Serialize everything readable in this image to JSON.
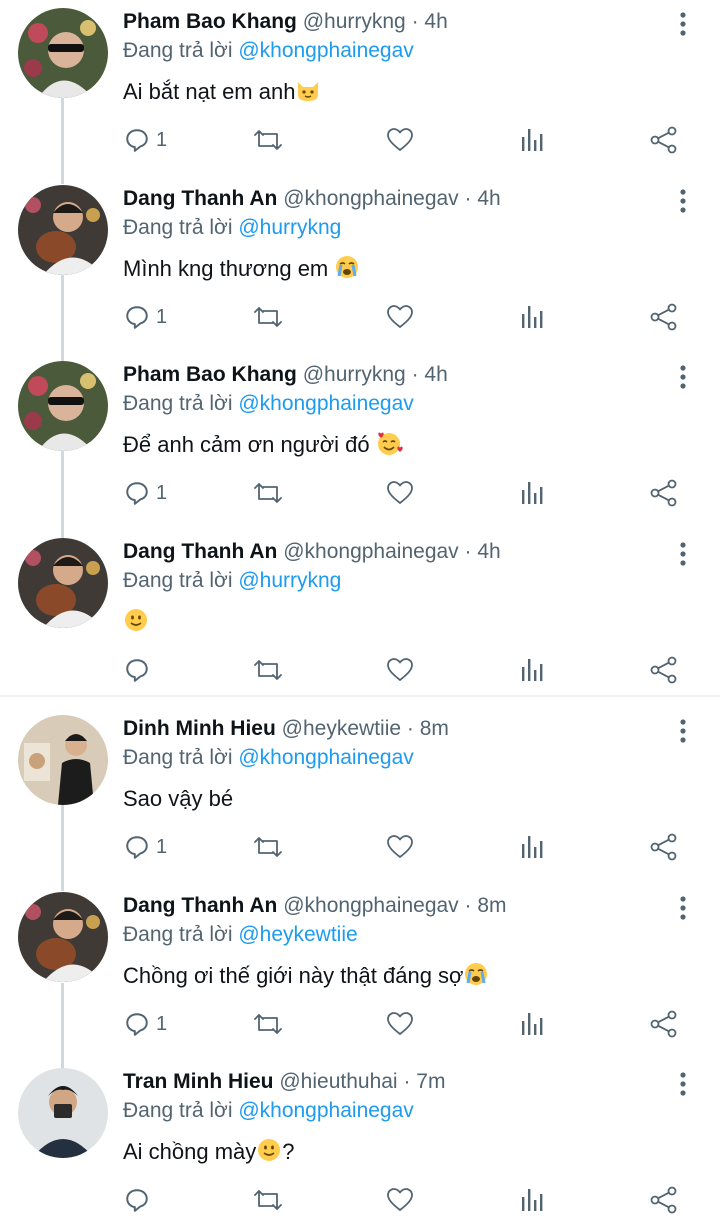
{
  "reply_prefix": "Đang trả lời",
  "tweets": [
    {
      "name": "Pham Bao Khang",
      "handle": "@hurrykng",
      "dot": "·",
      "time": "4h",
      "reply_to": "@khongphainegav",
      "text": "Ai bắt nạt em anh",
      "emoji": "cat-face-icon",
      "reply_count": "1"
    },
    {
      "name": "Dang Thanh An",
      "handle": "@khongphainegav",
      "dot": "·",
      "time": "4h",
      "reply_to": "@hurrykng",
      "text": "Mình kng thương em ",
      "emoji": "loudly-crying-face-icon",
      "reply_count": "1"
    },
    {
      "name": "Pham Bao Khang",
      "handle": "@hurrykng",
      "dot": "·",
      "time": "4h",
      "reply_to": "@khongphainegav",
      "text": "Để anh cảm ơn người đó ",
      "emoji": "smiling-face-with-hearts-icon",
      "reply_count": "1"
    },
    {
      "name": "Dang Thanh An",
      "handle": "@khongphainegav",
      "dot": "·",
      "time": "4h",
      "reply_to": "@hurrykng",
      "text": "",
      "emoji": "slightly-smiling-face-icon",
      "reply_count": ""
    },
    {
      "name": "Dinh Minh Hieu",
      "handle": "@heykewtiie",
      "dot": "·",
      "time": "8m",
      "reply_to": "@khongphainegav",
      "text": "Sao vậy bé",
      "emoji": "",
      "reply_count": "1"
    },
    {
      "name": "Dang Thanh An",
      "handle": "@khongphainegav",
      "dot": "·",
      "time": "8m",
      "reply_to": "@heykewtiie",
      "text": "Chồng ơi thế giới này thật đáng sợ",
      "emoji": "loudly-crying-face-icon",
      "reply_count": "1"
    },
    {
      "name": "Tran Minh Hieu",
      "handle": "@hieuthuhai",
      "dot": "·",
      "time": "7m",
      "reply_to": "@khongphainegav",
      "text": "Ai chồng mày",
      "text_after": "?",
      "emoji": "slightly-smiling-face-icon",
      "reply_count": ""
    }
  ],
  "colors": {
    "mention": "#1d9bf0",
    "secondary": "#536471",
    "thread_line": "#cfd9de",
    "emoji_yellow": "#ffcc4d"
  }
}
